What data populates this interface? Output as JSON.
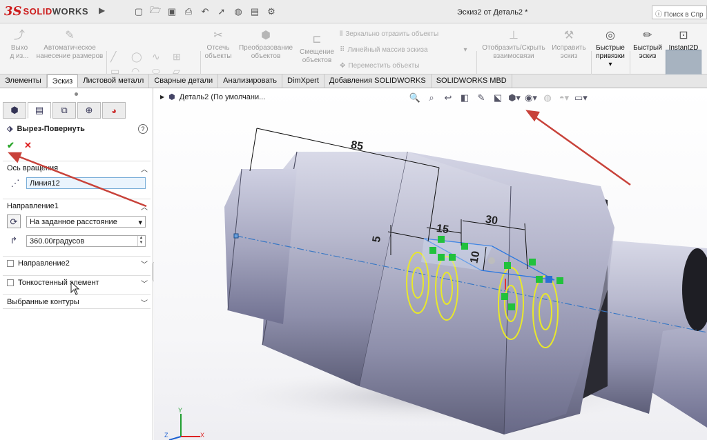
{
  "app": {
    "brand_ds": "3S",
    "brand_solid": "SOLID",
    "brand_works": "WORKS",
    "doc_title": "Эскиз2 от Деталь2 *",
    "search_placeholder": "Поиск в Спр"
  },
  "quick_access": [
    "new-icon",
    "open-icon",
    "save-icon",
    "print-icon",
    "undo-icon",
    "select-icon",
    "rebuild-icon",
    "file-props-icon",
    "options-icon"
  ],
  "toolbar": {
    "exit_sketch": "Выхо\nд из...",
    "smart_dim": "Автоматическое\nнанесение размеров",
    "trim": "Отсечь\nобъекты",
    "convert": "Преобразование\nобъектов",
    "offset": "Смещение\nобъектов",
    "mirror": "Зеркально отразить объекты",
    "linear_pattern": "Линейный массив эскиза",
    "move": "Переместить объекты",
    "display_relations": "Отобразить/Скрыть\nвзаимосвязи",
    "repair": "Исправить\nэскиз",
    "quick_snaps": "Быстрые\nпривязки",
    "rapid_sketch": "Быстрый\nэскиз",
    "instant2d": "Instant2D"
  },
  "tabs": [
    {
      "label": "Элементы",
      "active": false
    },
    {
      "label": "Эскиз",
      "active": true
    },
    {
      "label": "Листовой металл",
      "active": false
    },
    {
      "label": "Сварные детали",
      "active": false
    },
    {
      "label": "Анализировать",
      "active": false
    },
    {
      "label": "DimXpert",
      "active": false
    },
    {
      "label": "Добавления SOLIDWORKS",
      "active": false
    },
    {
      "label": "SOLIDWORKS MBD",
      "active": false
    }
  ],
  "property_manager": {
    "title": "Вырез-Повернуть",
    "ok": "✔",
    "cancel": "✕",
    "help": "?",
    "axis_section": "Ось вращения",
    "axis_value": "Линия12",
    "direction1_section": "Направление1",
    "end_condition": "На заданное расстояние",
    "angle_value": "360.00градусов",
    "direction2_section": "Направление2",
    "thin_section": "Тонкостенный элемент",
    "contours_section": "Выбранные контуры"
  },
  "tree": {
    "item": "Деталь2  (По умолчани..."
  },
  "dims": {
    "d85": "85",
    "d15": "15",
    "d30": "30",
    "d5": "5",
    "d10": "10"
  },
  "triad": {
    "x": "X",
    "y": "Y",
    "z": "Z"
  },
  "colors": {
    "accent": "#cc1b1b",
    "arrow": "#c8423a",
    "sketch": "#e8e82a",
    "relation": "#2ecc40"
  }
}
